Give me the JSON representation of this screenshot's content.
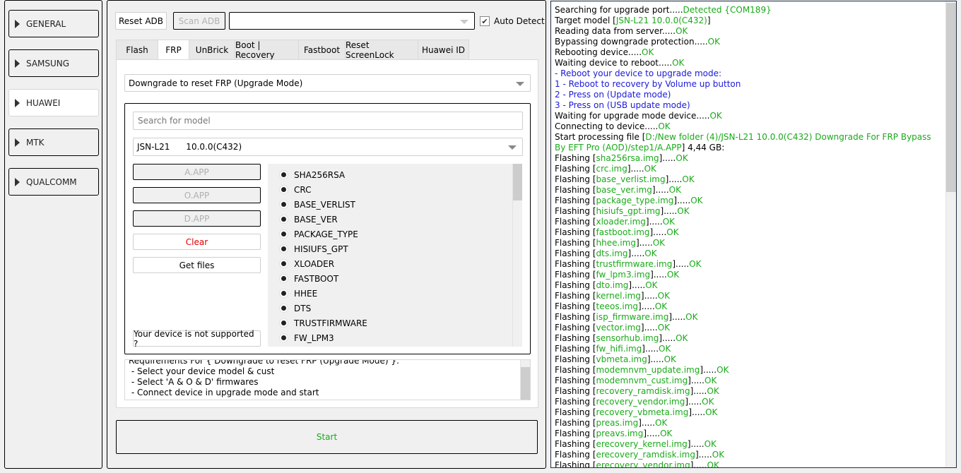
{
  "sidebar": {
    "items": [
      {
        "label": "GENERAL",
        "active": false
      },
      {
        "label": "SAMSUNG",
        "active": false
      },
      {
        "label": "HUAWEI",
        "active": true
      },
      {
        "label": "MTK",
        "active": false
      },
      {
        "label": "QUALCOMM",
        "active": false
      }
    ]
  },
  "toolbar": {
    "reset_adb": "Reset ADB",
    "scan_adb": "Scan ADB",
    "port_select_value": "",
    "auto_detect_label": "Auto Detect",
    "auto_detect_checked": true
  },
  "tabs": [
    {
      "label": "Flash",
      "active": false
    },
    {
      "label": "FRP",
      "active": true
    },
    {
      "label": "UnBrick",
      "active": false
    },
    {
      "label": "Boot | Recovery",
      "active": false
    },
    {
      "label": "Fastboot",
      "active": false
    },
    {
      "label": "Reset ScreenLock",
      "active": false
    },
    {
      "label": "Huawei ID",
      "active": false
    }
  ],
  "frp": {
    "method_value": "Downgrade to reset FRP (Upgrade Mode)",
    "search_placeholder": "Search for model",
    "model_value": "JSN-L21      10.0.0(C432)",
    "buttons": {
      "a_app": "A.APP",
      "o_app": "O.APP",
      "d_app": "D.APP",
      "clear": "Clear",
      "get_files": "Get files",
      "not_supported": "Your device is not supported ?"
    },
    "partitions": [
      {
        "label": "SHA256RSA",
        "checked": true
      },
      {
        "label": "CRC",
        "checked": true
      },
      {
        "label": "BASE_VERLIST",
        "checked": true
      },
      {
        "label": "BASE_VER",
        "checked": true
      },
      {
        "label": "PACKAGE_TYPE",
        "checked": true
      },
      {
        "label": "HISIUFS_GPT",
        "checked": true
      },
      {
        "label": "XLOADER",
        "checked": true
      },
      {
        "label": "FASTBOOT",
        "checked": true
      },
      {
        "label": "HHEE",
        "checked": true
      },
      {
        "label": "DTS",
        "checked": true
      },
      {
        "label": "TRUSTFIRMWARE",
        "checked": true
      },
      {
        "label": "FW_LPM3",
        "checked": true
      }
    ],
    "requirements": [
      "Requirements For { Downgrade to reset FRP (Upgrade Mode) }:",
      " - Select your device model & cust",
      " - Select 'A & O & D' firmwares",
      " - Connect device in upgrade mode and start"
    ],
    "start_label": "Start"
  },
  "colors": {
    "ok_green": "#1aaa1a",
    "info_blue": "#1a1adb",
    "clear_red": "#e00000"
  },
  "log": [
    {
      "parts": [
        {
          "t": "Searching for upgrade port....."
        },
        {
          "t": "Detected {COM189}",
          "c": "g"
        }
      ]
    },
    {
      "parts": [
        {
          "t": "Target model ["
        },
        {
          "t": "JSN-L21 10.0.0(C432)",
          "c": "g"
        },
        {
          "t": "]"
        }
      ]
    },
    {
      "parts": [
        {
          "t": "Reading data from server....."
        },
        {
          "t": "OK",
          "c": "g"
        }
      ]
    },
    {
      "parts": [
        {
          "t": "Bypassing downgrade protection....."
        },
        {
          "t": "OK",
          "c": "g"
        }
      ]
    },
    {
      "parts": [
        {
          "t": "Rebooting device....."
        },
        {
          "t": "OK",
          "c": "g"
        }
      ]
    },
    {
      "parts": [
        {
          "t": "Waiting device to reboot....."
        },
        {
          "t": "OK",
          "c": "g"
        }
      ]
    },
    {
      "parts": [
        {
          "t": "- Reboot your device to upgrade mode:",
          "c": "b"
        }
      ]
    },
    {
      "parts": [
        {
          "t": "1 - Reboot to recovery by Volume up button",
          "c": "b"
        }
      ]
    },
    {
      "parts": [
        {
          "t": "2 - Press on (Update mode)",
          "c": "b"
        }
      ]
    },
    {
      "parts": [
        {
          "t": "3 - Press on (USB update mode)",
          "c": "b"
        }
      ]
    },
    {
      "parts": [
        {
          "t": "Waiting for upgrade mode device....."
        },
        {
          "t": "OK",
          "c": "g"
        }
      ]
    },
    {
      "parts": [
        {
          "t": "Connecting to device....."
        },
        {
          "t": "OK",
          "c": "g"
        }
      ]
    },
    {
      "parts": [
        {
          "t": "Start processing file ["
        },
        {
          "t": "D:/New folder (4)/JSN-L21 10.0.0(C432) Downgrade For FRP Bypass By EFT Pro (AOD)/step1/A.APP",
          "c": "g"
        },
        {
          "t": "] 4,44 GB:"
        }
      ]
    },
    {
      "parts": [
        {
          "t": "Flashing ["
        },
        {
          "t": "sha256rsa.img",
          "c": "g"
        },
        {
          "t": "]....."
        },
        {
          "t": "OK",
          "c": "g"
        }
      ]
    },
    {
      "parts": [
        {
          "t": "Flashing ["
        },
        {
          "t": "crc.img",
          "c": "g"
        },
        {
          "t": "]....."
        },
        {
          "t": "OK",
          "c": "g"
        }
      ]
    },
    {
      "parts": [
        {
          "t": "Flashing ["
        },
        {
          "t": "base_verlist.img",
          "c": "g"
        },
        {
          "t": "]....."
        },
        {
          "t": "OK",
          "c": "g"
        }
      ]
    },
    {
      "parts": [
        {
          "t": "Flashing ["
        },
        {
          "t": "base_ver.img",
          "c": "g"
        },
        {
          "t": "]....."
        },
        {
          "t": "OK",
          "c": "g"
        }
      ]
    },
    {
      "parts": [
        {
          "t": "Flashing ["
        },
        {
          "t": "package_type.img",
          "c": "g"
        },
        {
          "t": "]....."
        },
        {
          "t": "OK",
          "c": "g"
        }
      ]
    },
    {
      "parts": [
        {
          "t": "Flashing ["
        },
        {
          "t": "hisiufs_gpt.img",
          "c": "g"
        },
        {
          "t": "]....."
        },
        {
          "t": "OK",
          "c": "g"
        }
      ]
    },
    {
      "parts": [
        {
          "t": "Flashing ["
        },
        {
          "t": "xloader.img",
          "c": "g"
        },
        {
          "t": "]....."
        },
        {
          "t": "OK",
          "c": "g"
        }
      ]
    },
    {
      "parts": [
        {
          "t": "Flashing ["
        },
        {
          "t": "fastboot.img",
          "c": "g"
        },
        {
          "t": "]....."
        },
        {
          "t": "OK",
          "c": "g"
        }
      ]
    },
    {
      "parts": [
        {
          "t": "Flashing ["
        },
        {
          "t": "hhee.img",
          "c": "g"
        },
        {
          "t": "]....."
        },
        {
          "t": "OK",
          "c": "g"
        }
      ]
    },
    {
      "parts": [
        {
          "t": "Flashing ["
        },
        {
          "t": "dts.img",
          "c": "g"
        },
        {
          "t": "]....."
        },
        {
          "t": "OK",
          "c": "g"
        }
      ]
    },
    {
      "parts": [
        {
          "t": "Flashing ["
        },
        {
          "t": "trustfirmware.img",
          "c": "g"
        },
        {
          "t": "]....."
        },
        {
          "t": "OK",
          "c": "g"
        }
      ]
    },
    {
      "parts": [
        {
          "t": "Flashing ["
        },
        {
          "t": "fw_lpm3.img",
          "c": "g"
        },
        {
          "t": "]....."
        },
        {
          "t": "OK",
          "c": "g"
        }
      ]
    },
    {
      "parts": [
        {
          "t": "Flashing ["
        },
        {
          "t": "dto.img",
          "c": "g"
        },
        {
          "t": "]....."
        },
        {
          "t": "OK",
          "c": "g"
        }
      ]
    },
    {
      "parts": [
        {
          "t": "Flashing ["
        },
        {
          "t": "kernel.img",
          "c": "g"
        },
        {
          "t": "]....."
        },
        {
          "t": "OK",
          "c": "g"
        }
      ]
    },
    {
      "parts": [
        {
          "t": "Flashing ["
        },
        {
          "t": "teeos.img",
          "c": "g"
        },
        {
          "t": "]....."
        },
        {
          "t": "OK",
          "c": "g"
        }
      ]
    },
    {
      "parts": [
        {
          "t": "Flashing ["
        },
        {
          "t": "isp_firmware.img",
          "c": "g"
        },
        {
          "t": "]....."
        },
        {
          "t": "OK",
          "c": "g"
        }
      ]
    },
    {
      "parts": [
        {
          "t": "Flashing ["
        },
        {
          "t": "vector.img",
          "c": "g"
        },
        {
          "t": "]....."
        },
        {
          "t": "OK",
          "c": "g"
        }
      ]
    },
    {
      "parts": [
        {
          "t": "Flashing ["
        },
        {
          "t": "sensorhub.img",
          "c": "g"
        },
        {
          "t": "]....."
        },
        {
          "t": "OK",
          "c": "g"
        }
      ]
    },
    {
      "parts": [
        {
          "t": "Flashing ["
        },
        {
          "t": "fw_hifi.img",
          "c": "g"
        },
        {
          "t": "]....."
        },
        {
          "t": "OK",
          "c": "g"
        }
      ]
    },
    {
      "parts": [
        {
          "t": "Flashing ["
        },
        {
          "t": "vbmeta.img",
          "c": "g"
        },
        {
          "t": "]....."
        },
        {
          "t": "OK",
          "c": "g"
        }
      ]
    },
    {
      "parts": [
        {
          "t": "Flashing ["
        },
        {
          "t": "modemnvm_update.img",
          "c": "g"
        },
        {
          "t": "]....."
        },
        {
          "t": "OK",
          "c": "g"
        }
      ]
    },
    {
      "parts": [
        {
          "t": "Flashing ["
        },
        {
          "t": "modemnvm_cust.img",
          "c": "g"
        },
        {
          "t": "]....."
        },
        {
          "t": "OK",
          "c": "g"
        }
      ]
    },
    {
      "parts": [
        {
          "t": "Flashing ["
        },
        {
          "t": "recovery_ramdisk.img",
          "c": "g"
        },
        {
          "t": "]....."
        },
        {
          "t": "OK",
          "c": "g"
        }
      ]
    },
    {
      "parts": [
        {
          "t": "Flashing ["
        },
        {
          "t": "recovery_vendor.img",
          "c": "g"
        },
        {
          "t": "]....."
        },
        {
          "t": "OK",
          "c": "g"
        }
      ]
    },
    {
      "parts": [
        {
          "t": "Flashing ["
        },
        {
          "t": "recovery_vbmeta.img",
          "c": "g"
        },
        {
          "t": "]....."
        },
        {
          "t": "OK",
          "c": "g"
        }
      ]
    },
    {
      "parts": [
        {
          "t": "Flashing ["
        },
        {
          "t": "preas.img",
          "c": "g"
        },
        {
          "t": "]....."
        },
        {
          "t": "OK",
          "c": "g"
        }
      ]
    },
    {
      "parts": [
        {
          "t": "Flashing ["
        },
        {
          "t": "preavs.img",
          "c": "g"
        },
        {
          "t": "]....."
        },
        {
          "t": "OK",
          "c": "g"
        }
      ]
    },
    {
      "parts": [
        {
          "t": "Flashing ["
        },
        {
          "t": "erecovery_kernel.img",
          "c": "g"
        },
        {
          "t": "]....."
        },
        {
          "t": "OK",
          "c": "g"
        }
      ]
    },
    {
      "parts": [
        {
          "t": "Flashing ["
        },
        {
          "t": "erecovery_ramdisk.img",
          "c": "g"
        },
        {
          "t": "]....."
        },
        {
          "t": "OK",
          "c": "g"
        }
      ]
    },
    {
      "parts": [
        {
          "t": "Flashing ["
        },
        {
          "t": "erecovery_vendor.img",
          "c": "g"
        },
        {
          "t": "]....."
        },
        {
          "t": "OK",
          "c": "g"
        }
      ]
    }
  ]
}
